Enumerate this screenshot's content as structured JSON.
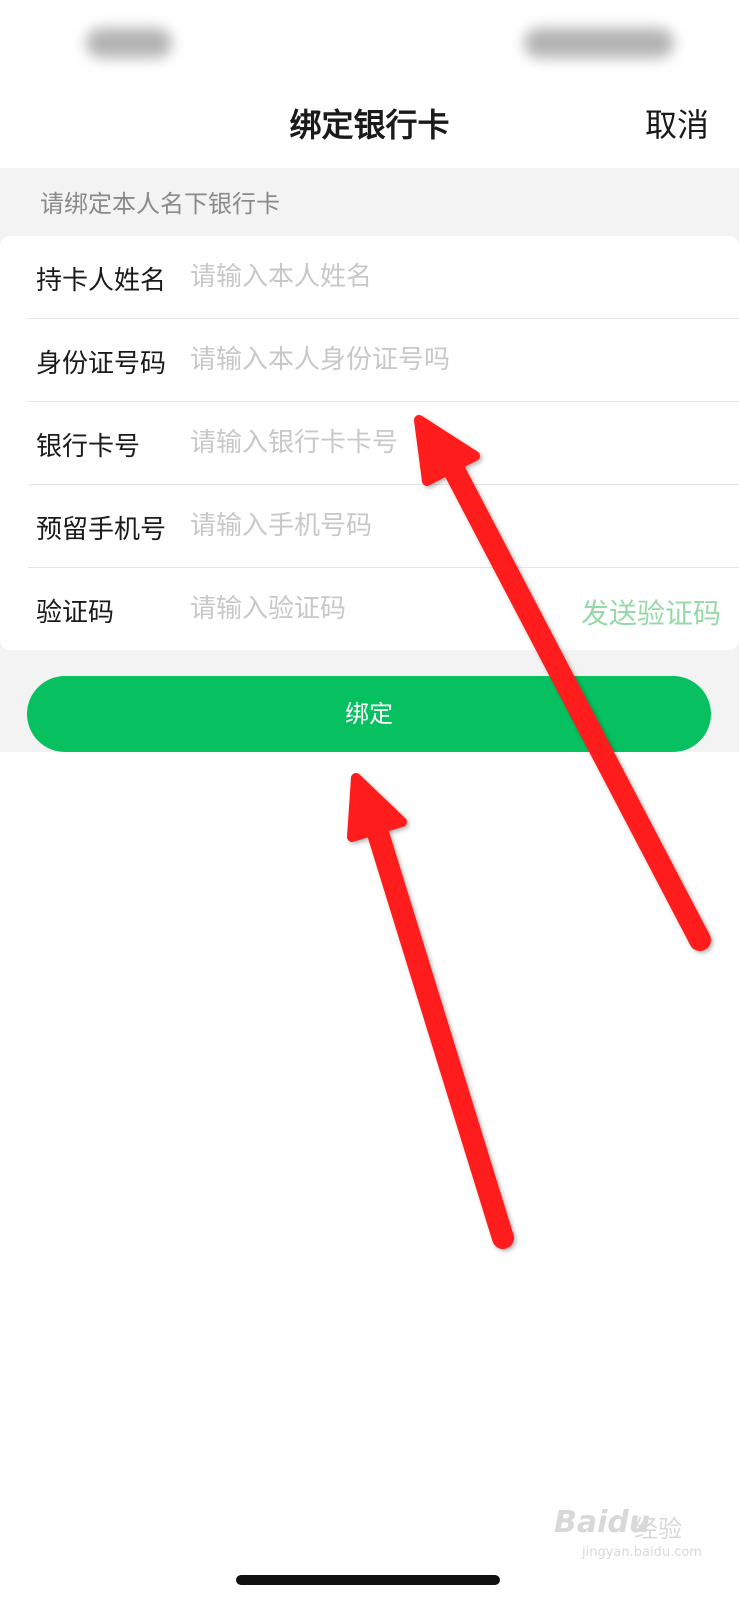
{
  "nav": {
    "title": "绑定银行卡",
    "cancel_label": "取消"
  },
  "form": {
    "hint": "请绑定本人名下银行卡",
    "fields": [
      {
        "label": "持卡人姓名",
        "placeholder": "请输入本人姓名"
      },
      {
        "label": "身份证号码",
        "placeholder": "请输入本人身份证号吗"
      },
      {
        "label": "银行卡号",
        "placeholder": "请输入银行卡卡号"
      },
      {
        "label": "预留手机号",
        "placeholder": "请输入手机号码"
      },
      {
        "label": "验证码",
        "placeholder": "请输入验证码"
      }
    ],
    "send_code_label": "发送验证码",
    "submit_label": "绑定"
  },
  "watermark": {
    "main": "Baidu",
    "cn": "经验",
    "url": "jingyan.baidu.com"
  },
  "colors": {
    "accent": "#07c160",
    "send_code_text": "#95d9a8",
    "annotation_arrow": "#ff1a1a",
    "background_gray": "#f3f3f3"
  }
}
